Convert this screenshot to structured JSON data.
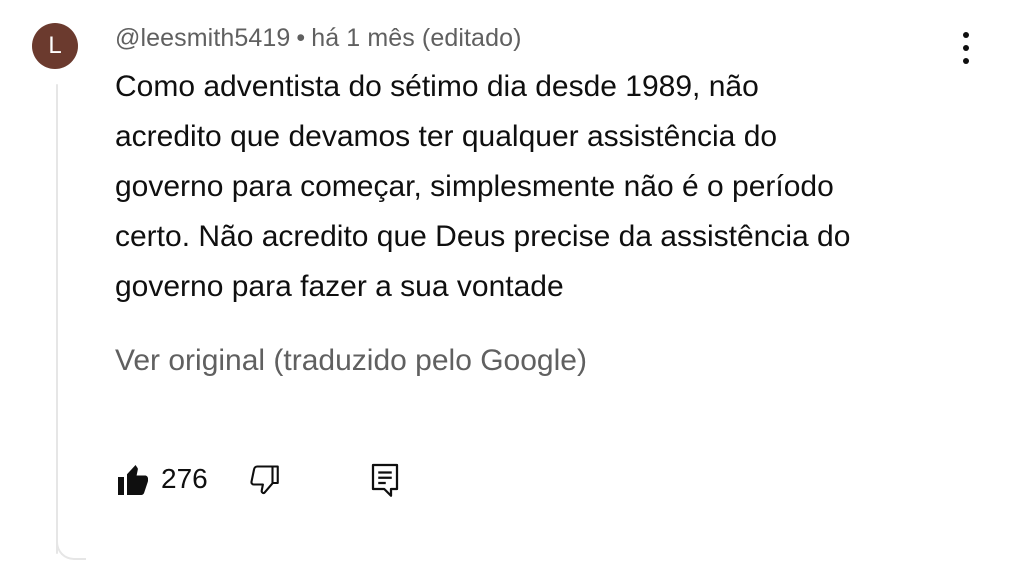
{
  "comment": {
    "avatar_letter": "L",
    "author": "@leesmith5419",
    "separator": "•",
    "time": "há 1 mês (editado)",
    "body_lines": [
      "Como adventista do sétimo dia desde 1989, não",
      "acredito que devamos ter qualquer assistência do",
      "governo para começar, simplesmente não é o período",
      "certo. Não acredito que Deus precise da assistência do",
      "governo para fazer a sua vontade"
    ],
    "translation_toggle": "Ver original (traduzido pelo Google)",
    "like_count": "276",
    "avatar_color": "#6b3a2e"
  },
  "icons": {
    "menu": "more-vertical-icon",
    "like": "thumbs-up-filled-icon",
    "dislike": "thumbs-down-outline-icon",
    "reply": "reply-comment-icon"
  }
}
